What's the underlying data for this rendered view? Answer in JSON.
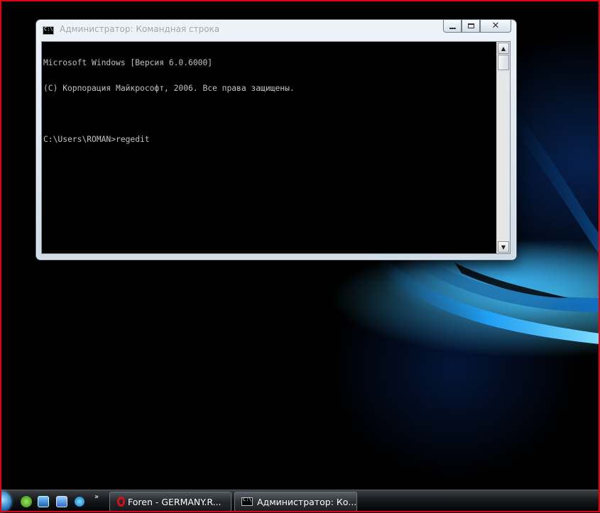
{
  "colors": {
    "frame_border": "#e8000b",
    "console_bg": "#000000",
    "console_text": "#c0c0c0",
    "accent_blue": "#1fa6ff"
  },
  "window": {
    "title": "Администратор: Командная строка",
    "icon": "cmd-icon",
    "controls": {
      "minimize": "minimize-icon",
      "maximize": "maximize-icon",
      "close": "close-icon",
      "close_glyph": "✕"
    }
  },
  "console": {
    "lines": [
      "Microsoft Windows [Версия 6.0.6000]",
      "(C) Корпорация Майкрософт, 2006. Все права защищены.",
      "",
      "C:\\Users\\ROMAN>regedit"
    ],
    "scroll_up_glyph": "▲",
    "scroll_down_glyph": "▼"
  },
  "taskbar": {
    "start_icon": "windows-orb-icon",
    "quick_launch": [
      "utorrent-icon",
      "show-desktop-icon",
      "switch-windows-icon",
      "skype-icon"
    ],
    "more_glyph": "»",
    "buttons": [
      {
        "label": "Foren - GERMANY.R...",
        "icon": "opera-icon"
      },
      {
        "label": "Администратор: Ко...",
        "icon": "cmd-icon"
      }
    ]
  }
}
